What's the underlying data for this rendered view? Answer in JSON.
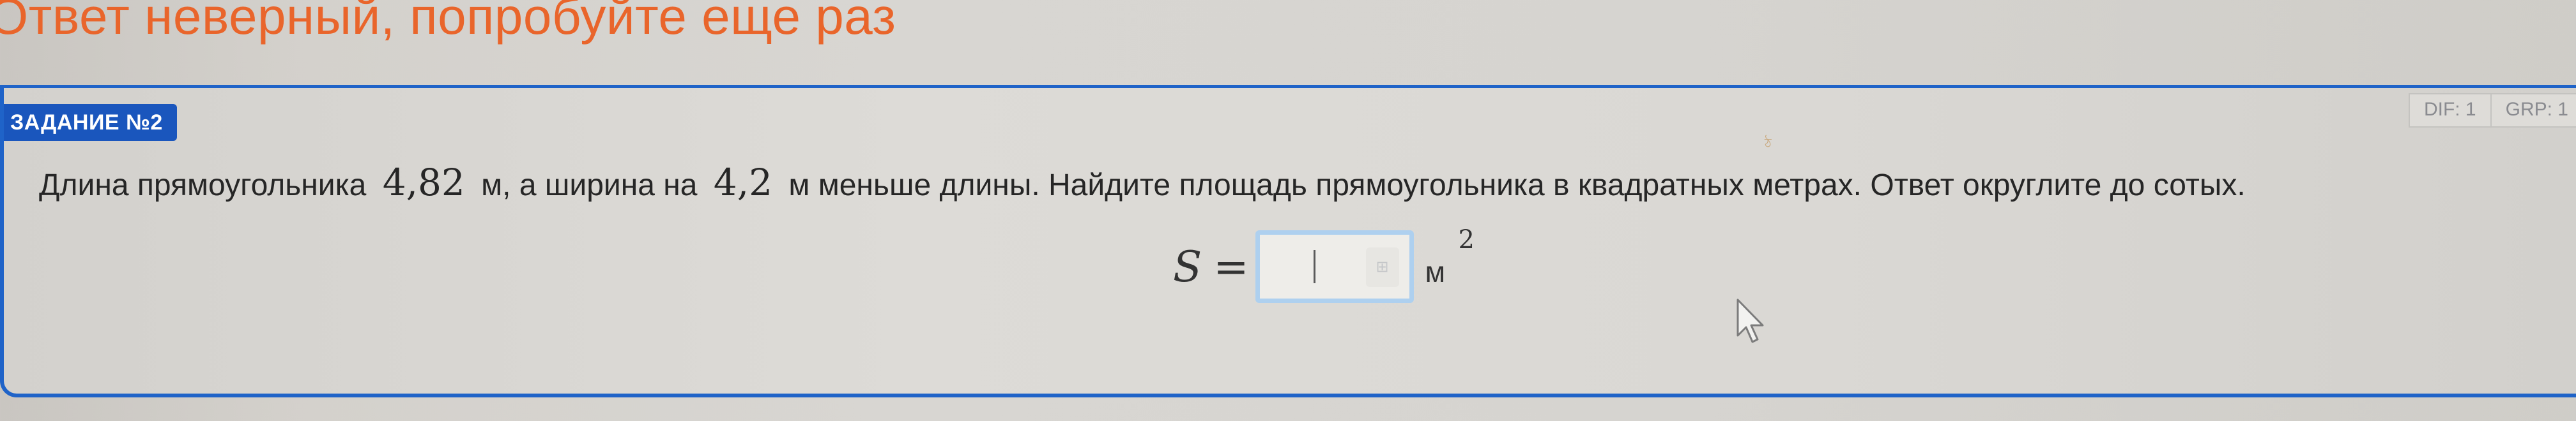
{
  "feedback": {
    "message": "Ответ неверный, попробуйте еще раз"
  },
  "task": {
    "badge": "ЗАДАНИЕ №2",
    "meta": {
      "difficulty": "DIF: 1",
      "group": "GRP: 1"
    },
    "statement": {
      "part1": "Длина прямоугольника",
      "length_value": "4,82",
      "part2": "м, а ширина на",
      "difference_value": "4,2",
      "part3": "м меньше длины. Найдите площадь прямоугольника в квадратных метрах. Ответ округлите до сотых."
    },
    "answer": {
      "variable": "S",
      "equals": "=",
      "input_value": "",
      "unit": "м",
      "unit_exponent": "2"
    }
  },
  "colors": {
    "feedback_error": "#e9652b",
    "accent_blue": "#1f63c8",
    "input_focus_border": "#aed0ef"
  },
  "icons": {
    "keypad": "keypad-icon",
    "cursor": "mouse-cursor-icon"
  }
}
